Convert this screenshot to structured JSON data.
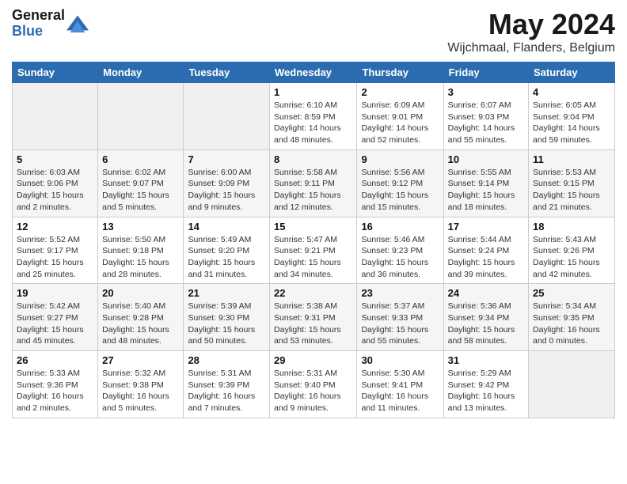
{
  "logo": {
    "general": "General",
    "blue": "Blue"
  },
  "header": {
    "month_year": "May 2024",
    "location": "Wijchmaal, Flanders, Belgium"
  },
  "days_of_week": [
    "Sunday",
    "Monday",
    "Tuesday",
    "Wednesday",
    "Thursday",
    "Friday",
    "Saturday"
  ],
  "weeks": [
    [
      {
        "num": "",
        "empty": true
      },
      {
        "num": "",
        "empty": true
      },
      {
        "num": "",
        "empty": true
      },
      {
        "num": "1",
        "rise": "Sunrise: 6:10 AM",
        "set": "Sunset: 8:59 PM",
        "daylight": "Daylight: 14 hours and 48 minutes."
      },
      {
        "num": "2",
        "rise": "Sunrise: 6:09 AM",
        "set": "Sunset: 9:01 PM",
        "daylight": "Daylight: 14 hours and 52 minutes."
      },
      {
        "num": "3",
        "rise": "Sunrise: 6:07 AM",
        "set": "Sunset: 9:03 PM",
        "daylight": "Daylight: 14 hours and 55 minutes."
      },
      {
        "num": "4",
        "rise": "Sunrise: 6:05 AM",
        "set": "Sunset: 9:04 PM",
        "daylight": "Daylight: 14 hours and 59 minutes."
      }
    ],
    [
      {
        "num": "5",
        "rise": "Sunrise: 6:03 AM",
        "set": "Sunset: 9:06 PM",
        "daylight": "Daylight: 15 hours and 2 minutes."
      },
      {
        "num": "6",
        "rise": "Sunrise: 6:02 AM",
        "set": "Sunset: 9:07 PM",
        "daylight": "Daylight: 15 hours and 5 minutes."
      },
      {
        "num": "7",
        "rise": "Sunrise: 6:00 AM",
        "set": "Sunset: 9:09 PM",
        "daylight": "Daylight: 15 hours and 9 minutes."
      },
      {
        "num": "8",
        "rise": "Sunrise: 5:58 AM",
        "set": "Sunset: 9:11 PM",
        "daylight": "Daylight: 15 hours and 12 minutes."
      },
      {
        "num": "9",
        "rise": "Sunrise: 5:56 AM",
        "set": "Sunset: 9:12 PM",
        "daylight": "Daylight: 15 hours and 15 minutes."
      },
      {
        "num": "10",
        "rise": "Sunrise: 5:55 AM",
        "set": "Sunset: 9:14 PM",
        "daylight": "Daylight: 15 hours and 18 minutes."
      },
      {
        "num": "11",
        "rise": "Sunrise: 5:53 AM",
        "set": "Sunset: 9:15 PM",
        "daylight": "Daylight: 15 hours and 21 minutes."
      }
    ],
    [
      {
        "num": "12",
        "rise": "Sunrise: 5:52 AM",
        "set": "Sunset: 9:17 PM",
        "daylight": "Daylight: 15 hours and 25 minutes."
      },
      {
        "num": "13",
        "rise": "Sunrise: 5:50 AM",
        "set": "Sunset: 9:18 PM",
        "daylight": "Daylight: 15 hours and 28 minutes."
      },
      {
        "num": "14",
        "rise": "Sunrise: 5:49 AM",
        "set": "Sunset: 9:20 PM",
        "daylight": "Daylight: 15 hours and 31 minutes."
      },
      {
        "num": "15",
        "rise": "Sunrise: 5:47 AM",
        "set": "Sunset: 9:21 PM",
        "daylight": "Daylight: 15 hours and 34 minutes."
      },
      {
        "num": "16",
        "rise": "Sunrise: 5:46 AM",
        "set": "Sunset: 9:23 PM",
        "daylight": "Daylight: 15 hours and 36 minutes."
      },
      {
        "num": "17",
        "rise": "Sunrise: 5:44 AM",
        "set": "Sunset: 9:24 PM",
        "daylight": "Daylight: 15 hours and 39 minutes."
      },
      {
        "num": "18",
        "rise": "Sunrise: 5:43 AM",
        "set": "Sunset: 9:26 PM",
        "daylight": "Daylight: 15 hours and 42 minutes."
      }
    ],
    [
      {
        "num": "19",
        "rise": "Sunrise: 5:42 AM",
        "set": "Sunset: 9:27 PM",
        "daylight": "Daylight: 15 hours and 45 minutes."
      },
      {
        "num": "20",
        "rise": "Sunrise: 5:40 AM",
        "set": "Sunset: 9:28 PM",
        "daylight": "Daylight: 15 hours and 48 minutes."
      },
      {
        "num": "21",
        "rise": "Sunrise: 5:39 AM",
        "set": "Sunset: 9:30 PM",
        "daylight": "Daylight: 15 hours and 50 minutes."
      },
      {
        "num": "22",
        "rise": "Sunrise: 5:38 AM",
        "set": "Sunset: 9:31 PM",
        "daylight": "Daylight: 15 hours and 53 minutes."
      },
      {
        "num": "23",
        "rise": "Sunrise: 5:37 AM",
        "set": "Sunset: 9:33 PM",
        "daylight": "Daylight: 15 hours and 55 minutes."
      },
      {
        "num": "24",
        "rise": "Sunrise: 5:36 AM",
        "set": "Sunset: 9:34 PM",
        "daylight": "Daylight: 15 hours and 58 minutes."
      },
      {
        "num": "25",
        "rise": "Sunrise: 5:34 AM",
        "set": "Sunset: 9:35 PM",
        "daylight": "Daylight: 16 hours and 0 minutes."
      }
    ],
    [
      {
        "num": "26",
        "rise": "Sunrise: 5:33 AM",
        "set": "Sunset: 9:36 PM",
        "daylight": "Daylight: 16 hours and 2 minutes."
      },
      {
        "num": "27",
        "rise": "Sunrise: 5:32 AM",
        "set": "Sunset: 9:38 PM",
        "daylight": "Daylight: 16 hours and 5 minutes."
      },
      {
        "num": "28",
        "rise": "Sunrise: 5:31 AM",
        "set": "Sunset: 9:39 PM",
        "daylight": "Daylight: 16 hours and 7 minutes."
      },
      {
        "num": "29",
        "rise": "Sunrise: 5:31 AM",
        "set": "Sunset: 9:40 PM",
        "daylight": "Daylight: 16 hours and 9 minutes."
      },
      {
        "num": "30",
        "rise": "Sunrise: 5:30 AM",
        "set": "Sunset: 9:41 PM",
        "daylight": "Daylight: 16 hours and 11 minutes."
      },
      {
        "num": "31",
        "rise": "Sunrise: 5:29 AM",
        "set": "Sunset: 9:42 PM",
        "daylight": "Daylight: 16 hours and 13 minutes."
      },
      {
        "num": "",
        "empty": true
      }
    ]
  ]
}
